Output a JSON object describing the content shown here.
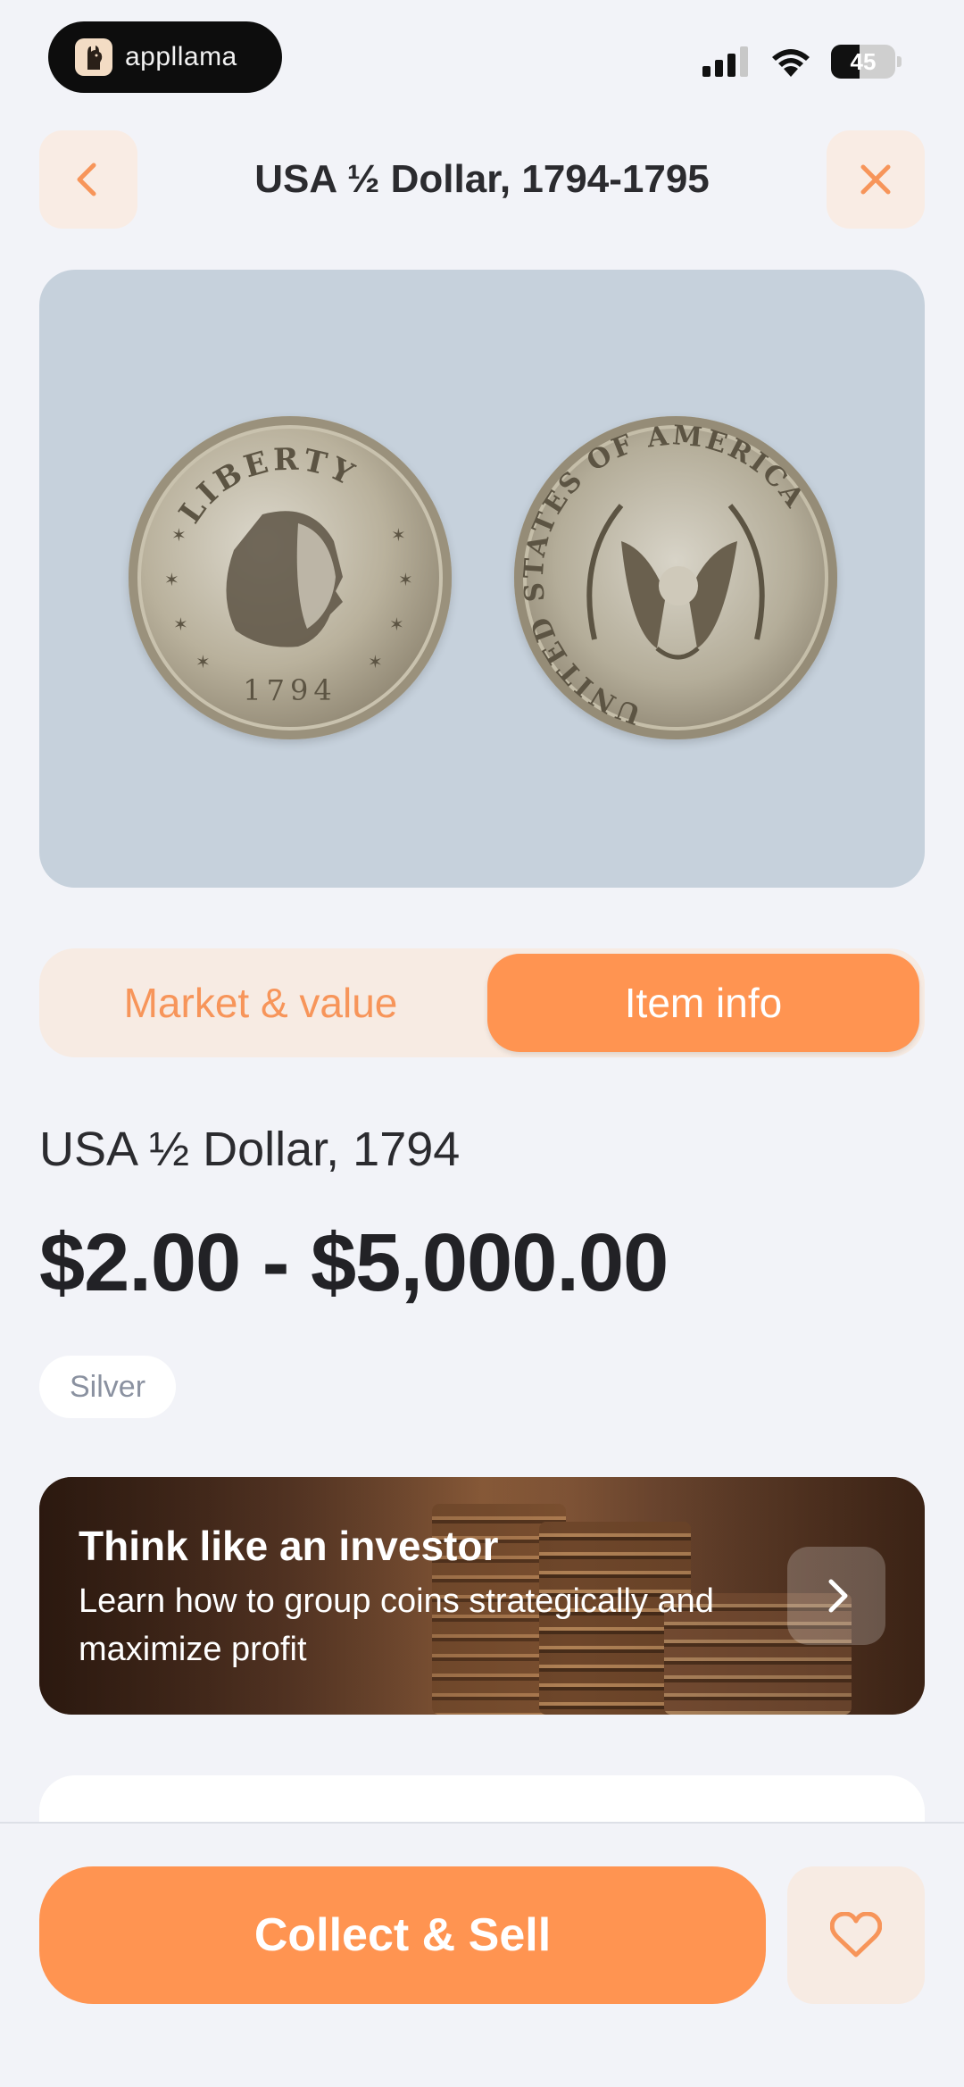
{
  "status_bar": {
    "app_name": "appllama",
    "battery_level": "45",
    "battery_fraction": 0.45,
    "icons": [
      "signal-icon",
      "wifi-icon",
      "battery-icon"
    ]
  },
  "header": {
    "title": "USA ½ Dollar, 1794-1795",
    "back_icon": "chevron-left-icon",
    "close_icon": "close-icon"
  },
  "coin_image": {
    "obverse_legend": "LIBERTY",
    "obverse_date": "1794",
    "reverse_legend": "UNITED STATES OF AMERICA"
  },
  "tabs": [
    {
      "label": "Market & value",
      "selected": false
    },
    {
      "label": "Item info",
      "selected": true
    }
  ],
  "item": {
    "name": "USA ½ Dollar, 1794",
    "price_range": "$2.00 - $5,000.00",
    "tag": "Silver"
  },
  "promo": {
    "title": "Think like an investor",
    "subtitle": "Learn how to group coins strategically and maximize profit",
    "arrow_icon": "chevron-right-icon"
  },
  "bottom_bar": {
    "cta_label": "Collect & Sell",
    "favorite_icon": "heart-icon"
  },
  "colors": {
    "accent": "#ff9451",
    "accent_soft": "#f7ebe3",
    "background": "#f2f3f8",
    "image_panel": "#c6d1dc"
  }
}
